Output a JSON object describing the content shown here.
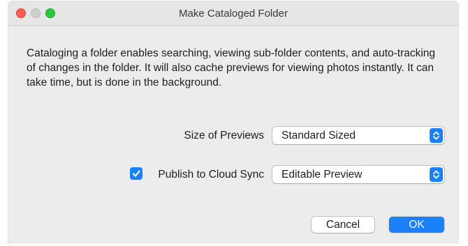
{
  "window": {
    "title": "Make Cataloged Folder"
  },
  "description": "Cataloging a folder enables searching, viewing sub-folder contents, and auto-tracking of changes in the folder. It will also cache previews for viewing photos instantly. It can take time, but is done in the background.",
  "preview_size": {
    "label": "Size of Previews",
    "selected": "Standard Sized",
    "icon": "updown-chevron-icon"
  },
  "cloud_sync": {
    "label": "Publish to Cloud Sync",
    "checked": true,
    "selected": "Editable Preview",
    "icon": "updown-chevron-icon"
  },
  "buttons": {
    "cancel_label": "Cancel",
    "ok_label": "OK"
  },
  "colors": {
    "accent": "#1b81fb",
    "close": "#fe5f57",
    "zoom": "#28c840",
    "minimize_inactive": "#cfcfcf"
  }
}
